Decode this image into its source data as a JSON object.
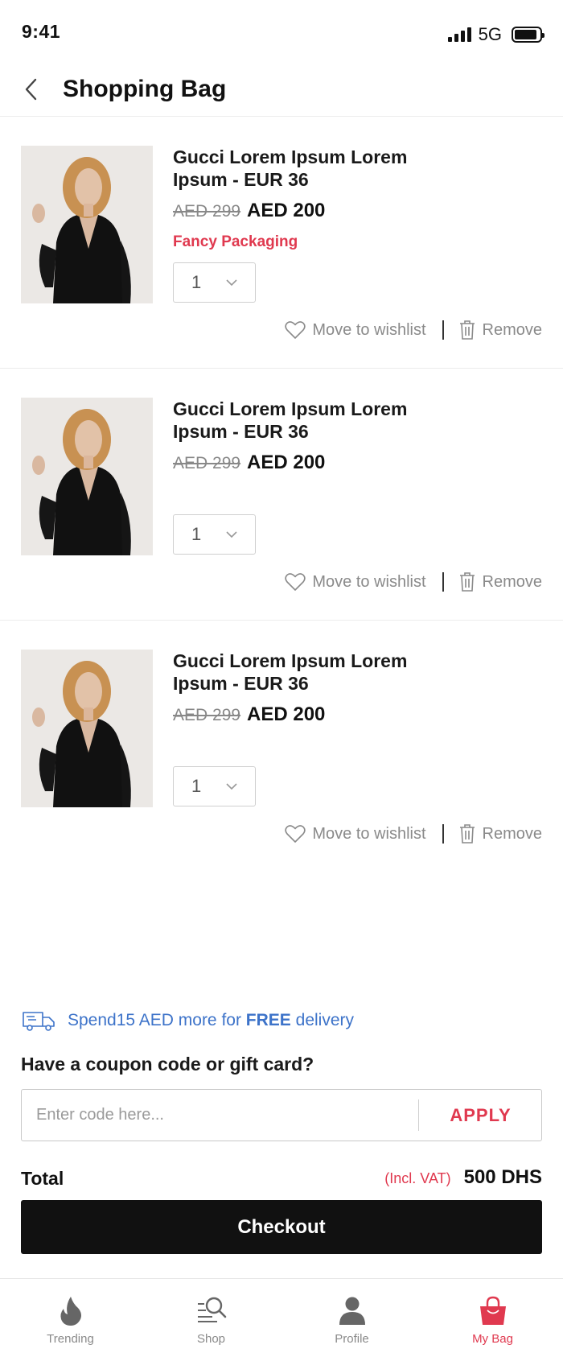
{
  "status_bar": {
    "time": "9:41",
    "network": "5G"
  },
  "header": {
    "title": "Shopping Bag"
  },
  "items": [
    {
      "name": "Gucci Lorem Ipsum Lorem Ipsum - EUR 36",
      "old_price": "AED 299",
      "new_price": "AED 200",
      "tag": "Fancy Packaging",
      "quantity": "1",
      "wishlist_label": "Move to wishlist",
      "remove_label": "Remove"
    },
    {
      "name": "Gucci Lorem Ipsum Lorem Ipsum - EUR 36",
      "old_price": "AED 299",
      "new_price": "AED 200",
      "tag": "",
      "quantity": "1",
      "wishlist_label": "Move to wishlist",
      "remove_label": "Remove"
    },
    {
      "name": "Gucci Lorem Ipsum Lorem Ipsum - EUR 36",
      "old_price": "AED 299",
      "new_price": "AED 200",
      "tag": "",
      "quantity": "1",
      "wishlist_label": "Move to wishlist",
      "remove_label": "Remove"
    }
  ],
  "promo": {
    "prefix": "Spend15 AED more for ",
    "highlight": "FREE",
    "suffix": " delivery",
    "icon": "delivery-truck-icon"
  },
  "coupon": {
    "label": "Have a coupon code or gift card?",
    "placeholder": "Enter code here...",
    "apply_label": "APPLY"
  },
  "total": {
    "label": "Total",
    "vat_note": "(Incl. VAT)",
    "value": "500 DHS"
  },
  "checkout": {
    "label": "Checkout"
  },
  "tab_bar": {
    "tabs": [
      {
        "label": "Trending",
        "icon": "flame-icon",
        "active": false
      },
      {
        "label": "Shop",
        "icon": "search-list-icon",
        "active": false
      },
      {
        "label": "Profile",
        "icon": "person-icon",
        "active": false
      },
      {
        "label": "My Bag",
        "icon": "shopping-bag-icon",
        "active": true
      }
    ]
  },
  "colors": {
    "accent": "#e0394f",
    "promo": "#3d73c9",
    "checkout_bg": "#111111",
    "muted": "#8a8a8a"
  }
}
